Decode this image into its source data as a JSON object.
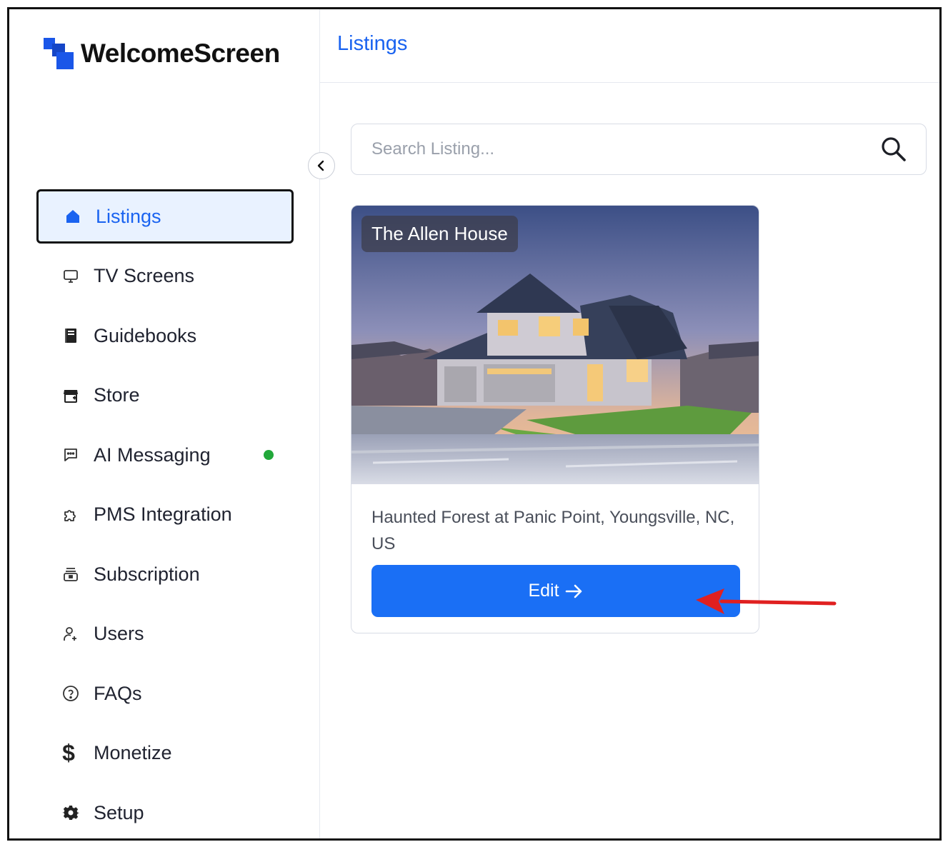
{
  "brand": {
    "name": "WelcomeScreen",
    "color": "#1a56e8"
  },
  "header": {
    "title": "Listings"
  },
  "sidebar": {
    "items": [
      {
        "label": "Listings",
        "icon": "home-icon",
        "active": true
      },
      {
        "label": "TV Screens",
        "icon": "monitor-icon"
      },
      {
        "label": "Guidebooks",
        "icon": "book-icon"
      },
      {
        "label": "Store",
        "icon": "store-icon"
      },
      {
        "label": "AI Messaging",
        "icon": "chat-icon",
        "status": "online"
      },
      {
        "label": "PMS Integration",
        "icon": "puzzle-icon"
      },
      {
        "label": "Subscription",
        "icon": "subscription-icon"
      },
      {
        "label": "Users",
        "icon": "user-add-icon"
      },
      {
        "label": "FAQs",
        "icon": "help-icon"
      },
      {
        "label": "Monetize",
        "icon": "dollar-icon"
      },
      {
        "label": "Setup",
        "icon": "gear-icon"
      }
    ]
  },
  "search": {
    "placeholder": "Search Listing..."
  },
  "listing": {
    "name": "The Allen House",
    "address": "Haunted Forest at Panic Point, Youngsville, NC, US",
    "edit_label": "Edit"
  },
  "colors": {
    "accent": "#1a6ff5",
    "active_bg": "#e9f2ff",
    "status_online": "#22a83a",
    "annotation": "#e02020"
  }
}
